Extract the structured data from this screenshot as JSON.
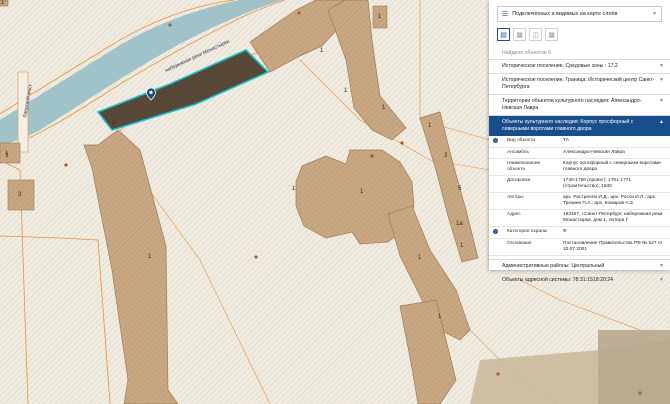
{
  "map": {
    "building_labels": [
      "1",
      "1",
      "1",
      "1",
      "1",
      "1",
      "1",
      "1",
      "1",
      "3",
      "3",
      "3",
      "5",
      "1",
      "1",
      "1а",
      "1",
      "1",
      "1"
    ],
    "street_labels": [
      "набережная реки Монастырки",
      "Лаврский мост"
    ]
  },
  "panel": {
    "layer_select": "Подключённых и видимых на карте слоёв",
    "found": "Найдено объектов 6",
    "sections": [
      {
        "label": "Историческое поселение. Средовые зоны : 17.2"
      },
      {
        "label": "Историческое поселение. Граница: Исторический центр Санкт-Петербурга"
      },
      {
        "label": "Территории объектов культурного наследия: Александро-Невская Лавра"
      }
    ],
    "open_section": {
      "label": "Объекты культурного наследия: Корпус просфорный с северными воротами главного двора",
      "rows": [
        {
          "key": "Вид объекта",
          "value": "ТА",
          "help": true
        },
        {
          "key": "Ансамбль",
          "value": "Александро-Невская Лавра",
          "help": false
        },
        {
          "key": "Наименование объекта",
          "value": "Корпус просфорный с северными воротами главного двора",
          "help": false
        },
        {
          "key": "Датировка",
          "value": "1740-1750 (проект); 1761-1771 (строительство); 1840",
          "help": false
        },
        {
          "key": "Авторы",
          "value": "арх. Растрелли И.Д., арх. Росси И.Л., арх. Трезини П.А.; арх. Комаров А.З.",
          "help": false
        },
        {
          "key": "Адрес",
          "value": "193167, г.Санкт-Петербург, набережная реки Монастырки, дом 1, литера Г",
          "help": false
        },
        {
          "key": "Категория охраны",
          "value": "Ф",
          "help": true
        },
        {
          "key": "Основание",
          "value": "Постановление Правительства РФ № 527 от 10.07.2001",
          "help": false
        }
      ]
    },
    "bottom_sections": [
      {
        "label": "Административные районы: Центральный"
      },
      {
        "label": "Объекты адресной системы: 78:31:1518:20:24"
      }
    ]
  },
  "colors": {
    "building": "#c8a882",
    "building_edge": "#9e7a52",
    "parcel_line": "#e8923a",
    "river": "#9fc3c9",
    "selected": "#5a4a3a",
    "selected_edge": "#17c0c8",
    "accent": "#1a4d8c"
  },
  "icons": [
    "layers-icon",
    "list-icon",
    "grid-icon",
    "columns-icon",
    "table-icon",
    "map-pin-icon",
    "help-icon",
    "chevron-down-icon",
    "chevron-up-icon"
  ]
}
